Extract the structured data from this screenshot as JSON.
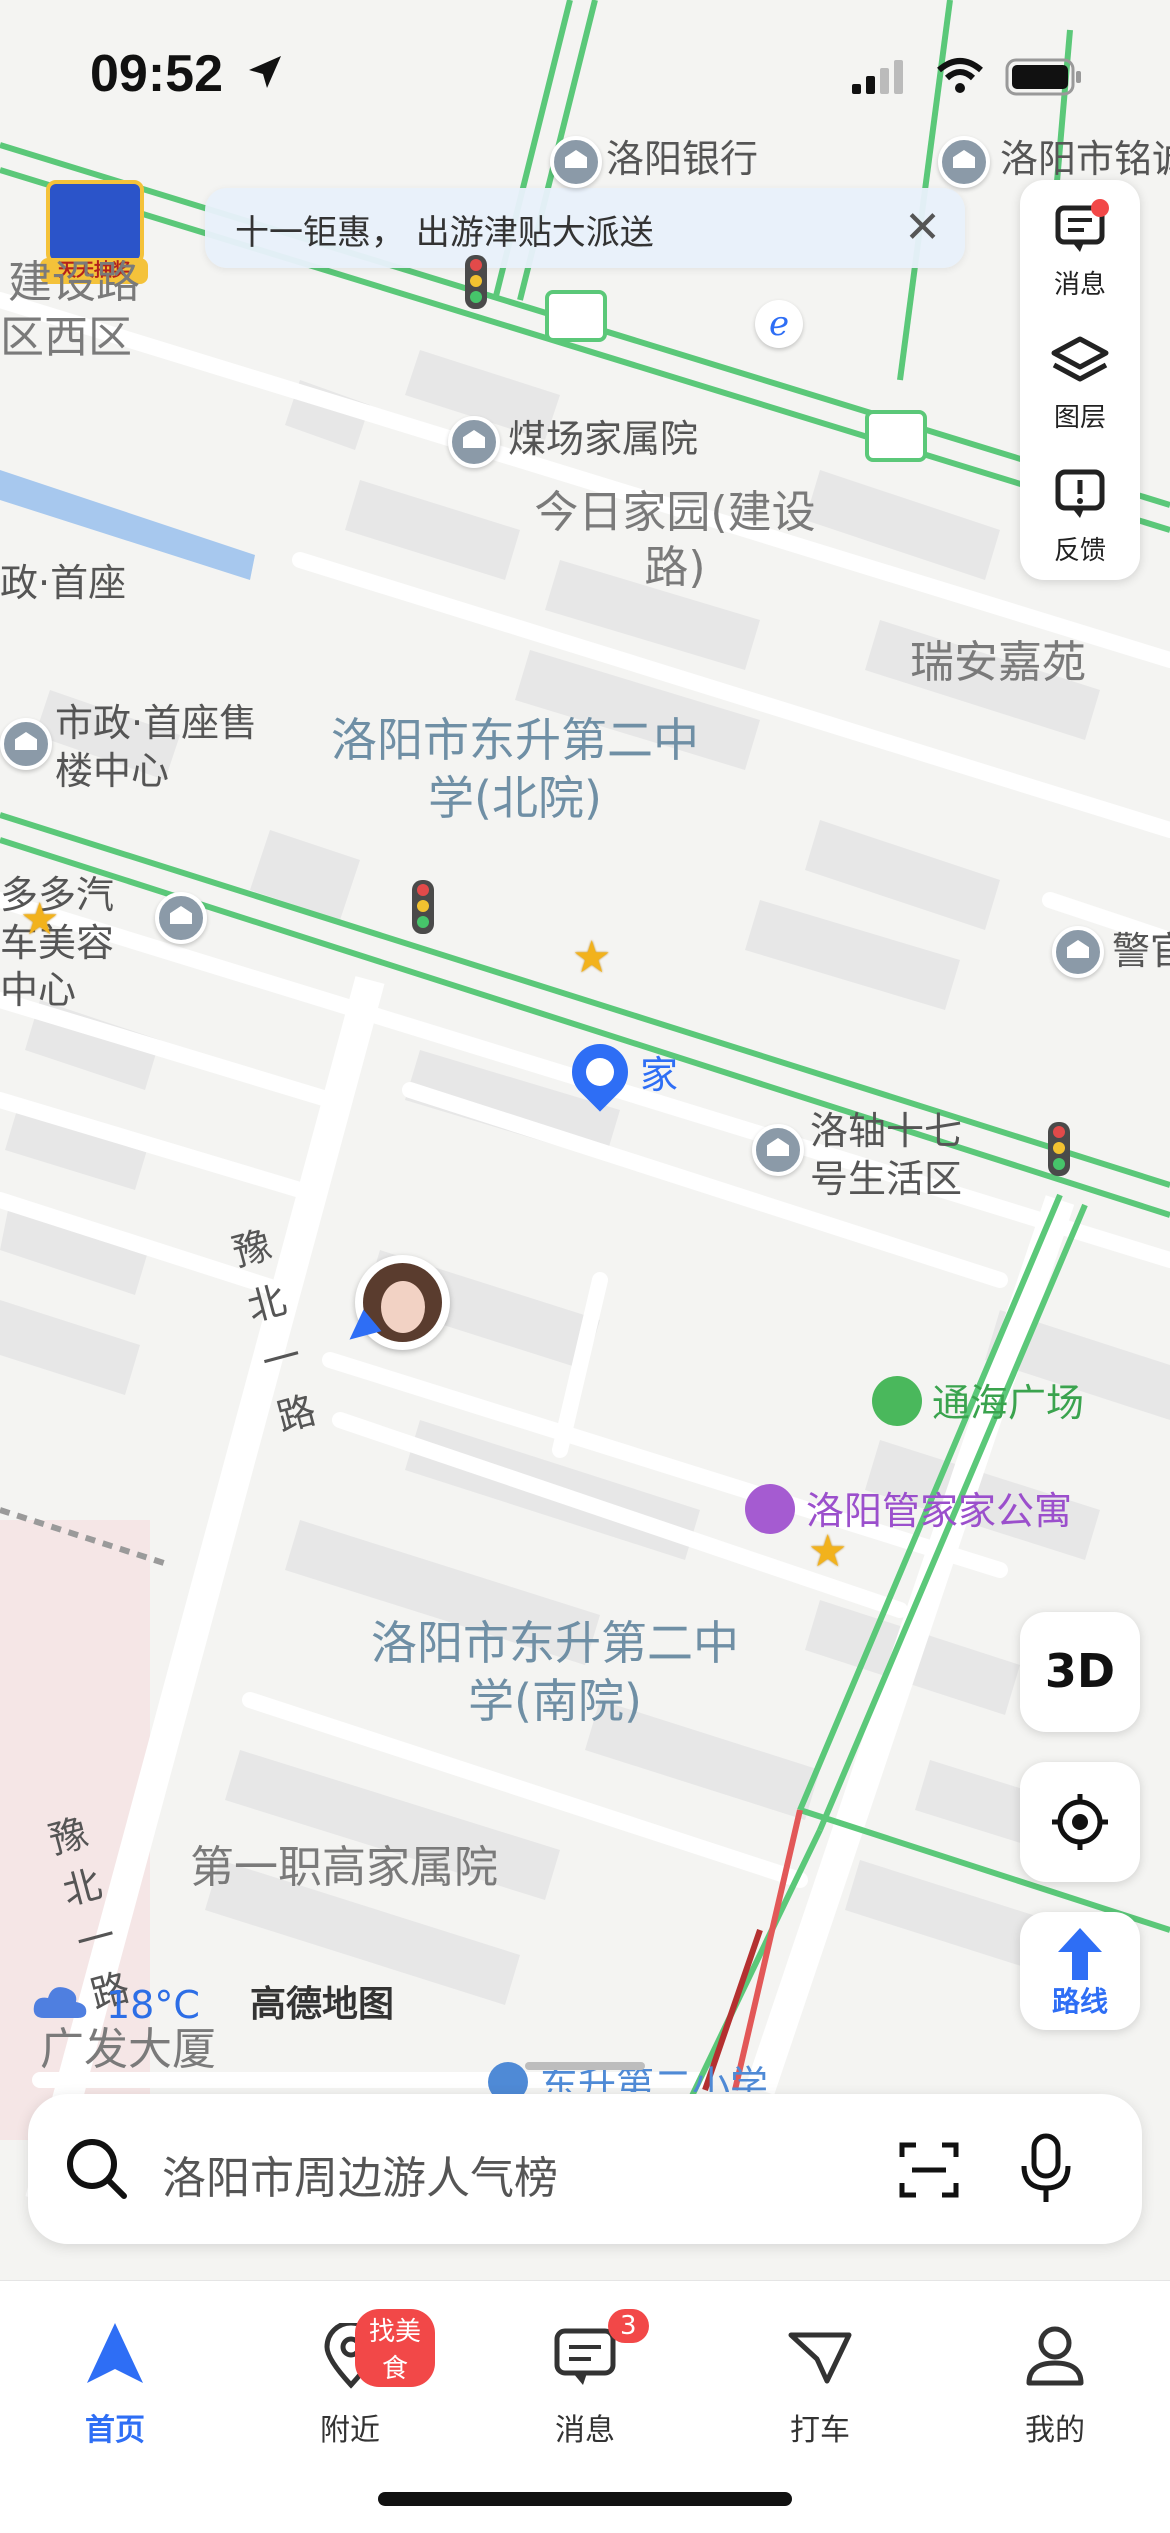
{
  "status_bar": {
    "time": "09:52"
  },
  "banner": {
    "text": "十一钜惠， 出游津贴大派送"
  },
  "lottery": {
    "label": "天天抽奖"
  },
  "side_panel": {
    "messages": "消息",
    "layers": "图层",
    "feedback": "反馈"
  },
  "map_labels": {
    "luoyang_bank": "洛阳银行",
    "mingxin": "洛阳市铭诚",
    "jianshe_road": "建设路",
    "xi_qu": "区西区",
    "meichang": "煤场家属院",
    "jinri_home": "今日家园(建设路)",
    "zheng_shouzuo": "政·首座",
    "ruian": "瑞安嘉苑",
    "shouzuo_sales": "市政·首座售楼中心",
    "school_north": "洛阳市东升第二中学(北院)",
    "auto_beauty": "多多汽车美容中心",
    "jing": "警官",
    "home": "家",
    "luozhou_17": "洛轴十七号生活区",
    "yubei_road": "豫北一路",
    "tonghai": "通海广场",
    "guanjia": "洛阳管家家公寓",
    "school_south": "洛阳市东升第二中学(南院)",
    "zhigao": "第一职高家属院",
    "yubei_road2": "豫北一路",
    "guangfa": "广发大厦",
    "dongsheng_primary": "东升第二小学"
  },
  "weather": {
    "temp": "18°C"
  },
  "brand": "高德地图",
  "buttons": {
    "three_d": "3D",
    "route": "路线"
  },
  "search": {
    "placeholder": "洛阳市周边游人气榜"
  },
  "tabs": [
    {
      "label": "首页",
      "active": true
    },
    {
      "label": "附近",
      "badge": "找美食"
    },
    {
      "label": "消息",
      "badge": "3"
    },
    {
      "label": "打车"
    },
    {
      "label": "我的"
    }
  ],
  "colors": {
    "accent": "#2e6ef5",
    "road_green": "#5bc879",
    "badge_red": "#f24848"
  }
}
